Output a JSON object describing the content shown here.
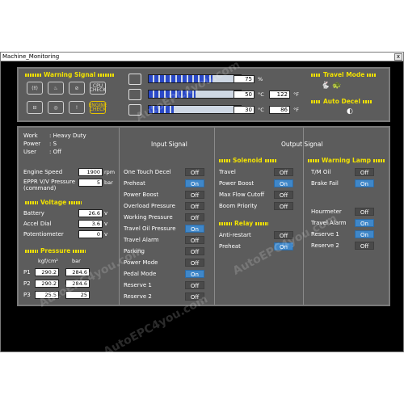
{
  "window": {
    "title": "Machine_Monitoring",
    "close_label": "x"
  },
  "top": {
    "warning_signal_title": "Warning Signal",
    "warning_icons": [
      {
        "icon": "warning-light-icon",
        "text": "(‼)"
      },
      {
        "icon": "coolant-temp-icon",
        "text": "♨"
      },
      {
        "icon": "oil-can-icon",
        "text": "⊘"
      },
      {
        "icon": "cpu-check-icon",
        "text": "CPU CHECK"
      },
      {
        "icon": "battery-icon",
        "text": "⊟"
      },
      {
        "icon": "engine-oil-icon",
        "text": "◎"
      },
      {
        "icon": "warning-exclaim-icon",
        "text": "!"
      },
      {
        "icon": "engine-check-icon",
        "text": "ENGINE CHECK"
      }
    ],
    "gauges": [
      {
        "name": "fuel",
        "fill": 0.75,
        "value": "75",
        "unit": "%",
        "extra_value": "",
        "extra_unit": ""
      },
      {
        "name": "coolant",
        "fill": 0.55,
        "value": "50",
        "unit": "°C",
        "extra_value": "122",
        "extra_unit": "°F"
      },
      {
        "name": "hydraulic-oil",
        "fill": 0.3,
        "value": "30",
        "unit": "°C",
        "extra_value": "86",
        "extra_unit": "°F"
      }
    ],
    "travel_mode_title": "Travel Mode",
    "auto_decel_title": "Auto Decel"
  },
  "status": {
    "work_label": "Work",
    "work_value": ": Heavy Duty",
    "power_label": "Power",
    "power_value": ": S",
    "user_label": "User",
    "user_value": ": Off"
  },
  "engine": {
    "speed_label": "Engine Speed",
    "speed_value": "1900",
    "speed_unit": "rpm",
    "epprv_label": "EPPR V/V Pressure",
    "epprv_sub": "(command)",
    "epprv_value": "5",
    "epprv_unit": "bar"
  },
  "voltage": {
    "title": "Voltage",
    "rows": [
      {
        "label": "Battery",
        "value": "26.6",
        "unit": "v"
      },
      {
        "label": "Accel Dial",
        "value": "3.6",
        "unit": "v"
      },
      {
        "label": "Potentiometer",
        "value": "0",
        "unit": "v"
      }
    ]
  },
  "pressure": {
    "title": "Pressure",
    "col1": "kgf/cm²",
    "col2": "bar",
    "rows": [
      {
        "label": "P1",
        "kgf": "290.2",
        "bar": "284.6"
      },
      {
        "label": "P2",
        "kgf": "290.2",
        "bar": "284.6"
      },
      {
        "label": "P3",
        "kgf": "25.5",
        "bar": "25"
      }
    ]
  },
  "input_signal": {
    "title": "Input Signal",
    "rows": [
      {
        "label": "One Touch Decel",
        "state": "Off"
      },
      {
        "label": "Preheat",
        "state": "On"
      },
      {
        "label": "Power Boost",
        "state": "Off"
      },
      {
        "label": "Overload Pressure",
        "state": "Off"
      },
      {
        "label": "Working Pressure",
        "state": "Off"
      },
      {
        "label": "Travel Oil Pressure",
        "state": "On"
      },
      {
        "label": "Travel Alarm",
        "state": "Off"
      },
      {
        "label": "Parking",
        "state": "Off"
      },
      {
        "label": "Power Mode",
        "state": "Off"
      },
      {
        "label": "Pedal Mode",
        "state": "On"
      },
      {
        "label": "Reserve 1",
        "state": "Off"
      },
      {
        "label": "Reserve 2",
        "state": "Off"
      }
    ]
  },
  "output_signal": {
    "title": "Output Signal"
  },
  "solenoid": {
    "title": "Solenoid",
    "rows": [
      {
        "label": "Travel",
        "state": "Off"
      },
      {
        "label": "Power Boost",
        "state": "On"
      },
      {
        "label": "Max Flow Cutoff",
        "state": "Off"
      },
      {
        "label": "Boom Priority",
        "state": "Off"
      }
    ]
  },
  "relay": {
    "title": "Relay",
    "rows": [
      {
        "label": "Anti-restart",
        "state": "Off"
      },
      {
        "label": "Preheat",
        "state": "On"
      }
    ]
  },
  "warning_lamp": {
    "title": "Warning Lamp",
    "rows": [
      {
        "label": "T/M Oil",
        "state": "Off"
      },
      {
        "label": "Brake Fail",
        "state": "On"
      }
    ],
    "rows2": [
      {
        "label": "Hourmeter",
        "state": "Off"
      },
      {
        "label": "Travel Alarm",
        "state": "On"
      },
      {
        "label": "Reserve 1",
        "state": "On"
      },
      {
        "label": "Reserve 2",
        "state": "Off"
      }
    ]
  },
  "colors": {
    "panel": "#5c5c5c",
    "on": "#3f87c9",
    "off": "#4a4a4a",
    "title": "#f2e200"
  },
  "watermark": "AutoEPC4you.com"
}
